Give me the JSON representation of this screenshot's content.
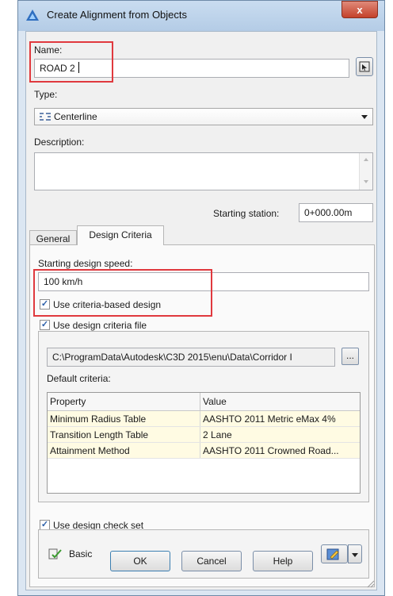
{
  "window": {
    "title": "Create Alignment from Objects",
    "close_label": "x"
  },
  "name": {
    "label": "Name:",
    "value": "ROAD 2"
  },
  "type": {
    "label": "Type:",
    "value": "Centerline"
  },
  "description": {
    "label": "Description:",
    "value": ""
  },
  "starting_station": {
    "label": "Starting station:",
    "value": "0+000.00m"
  },
  "tabs": [
    {
      "label": "General"
    },
    {
      "label": "Design Criteria"
    }
  ],
  "design": {
    "speed_label": "Starting design speed:",
    "speed_value": "100 km/h",
    "use_criteria_label": "Use criteria-based design",
    "use_file_label": "Use design criteria file",
    "file_path": "C:\\ProgramData\\Autodesk\\C3D 2015\\enu\\Data\\Corridor I",
    "browse_label": "...",
    "default_criteria_label": "Default criteria:",
    "columns": [
      "Property",
      "Value"
    ],
    "rows": [
      [
        "Minimum Radius Table",
        "AASHTO 2011 Metric eMax 4%"
      ],
      [
        "Transition Length Table",
        "2 Lane"
      ],
      [
        "Attainment Method",
        "AASHTO 2011 Crowned Road..."
      ]
    ],
    "check_set_label": "Use design check set",
    "check_set_value": "Basic"
  },
  "buttons": {
    "ok": "OK",
    "cancel": "Cancel",
    "help": "Help"
  },
  "colors": {
    "highlight_red": "#e0393e",
    "tab_row_yellow": "#fffbe3"
  }
}
